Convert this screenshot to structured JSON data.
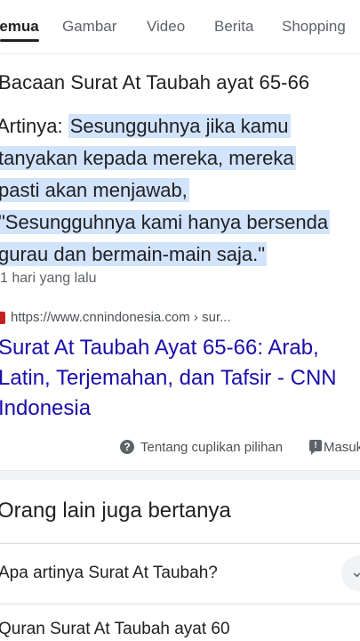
{
  "tabs": [
    "Semua",
    "Gambar",
    "Video",
    "Berita",
    "Shopping"
  ],
  "snippet": {
    "title": "Bacaan Surat At Taubah ayat 65-66",
    "prefix": "Artinya: ",
    "lines": [
      "Sesungguhnya jika kamu",
      "tanyakan kepada mereka, mereka",
      "pasti akan menjawab,",
      "\"Sesungguhnya kami hanya bersenda",
      "gurau dan bermain-main saja.\""
    ],
    "time": "1 hari yang lalu"
  },
  "source": {
    "favicon": "cnn-favicon",
    "url": "https://www.cnnindonesia.com › sur...",
    "title_lines": [
      "Surat At Taubah Ayat 65-66: Arab,",
      "Latin, Terjemahan, dan Tafsir - CNN",
      "Indonesia"
    ]
  },
  "about": {
    "icon": "help-circle-icon",
    "label": "Tentang cuplikan pilihan"
  },
  "feedback": {
    "icon": "feedback-icon",
    "label": "Masukan"
  },
  "paa": {
    "title": "Orang lain juga bertanya",
    "questions": [
      "Apa artinya Surat At Taubah?",
      "Quran Surat At Taubah ayat 60"
    ]
  },
  "colors": {
    "highlight": "#d2e3fc",
    "link": "#1a0dab",
    "muted": "#5f6368",
    "favicon": "#c5221f"
  }
}
